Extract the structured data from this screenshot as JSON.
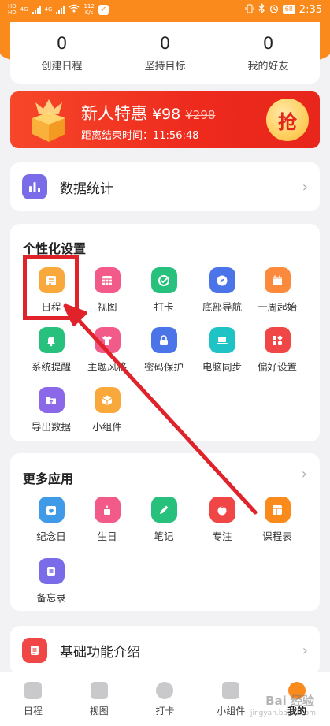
{
  "status_bar": {
    "net_label_1": "HD",
    "net_label_2": "HD",
    "gen_1": "4G",
    "gen_2": "4G",
    "speed_value": "112",
    "speed_unit": "K/s",
    "battery": "68",
    "time": "2:35"
  },
  "stats": [
    {
      "value": "0",
      "label": "创建日程"
    },
    {
      "value": "0",
      "label": "坚持目标"
    },
    {
      "value": "0",
      "label": "我的好友"
    }
  ],
  "promo": {
    "title": "新人特惠",
    "price": "¥98",
    "old_price": "¥298",
    "countdown": "距离结束时间：11:56:48",
    "button": "抢"
  },
  "data_stats": {
    "label": "数据统计",
    "color": "#7a6be8"
  },
  "personalize": {
    "title": "个性化设置",
    "items": [
      {
        "label": "日程",
        "icon": "schedule-icon",
        "color": "#f9a93c"
      },
      {
        "label": "视图",
        "icon": "grid-view-icon",
        "color": "#f25a8a"
      },
      {
        "label": "打卡",
        "icon": "checkin-icon",
        "color": "#27c07d"
      },
      {
        "label": "底部导航",
        "icon": "compass-icon",
        "color": "#4b74e8"
      },
      {
        "label": "一周起始",
        "icon": "calendar-icon",
        "color": "#fb8a3c"
      },
      {
        "label": "系统提醒",
        "icon": "bell-icon",
        "color": "#27c07d"
      },
      {
        "label": "主题风格",
        "icon": "shirt-icon",
        "color": "#f25a8a"
      },
      {
        "label": "密码保护",
        "icon": "lock-icon",
        "color": "#4b74e8"
      },
      {
        "label": "电脑同步",
        "icon": "laptop-icon",
        "color": "#1fc3c6"
      },
      {
        "label": "偏好设置",
        "icon": "apps-icon",
        "color": "#f04646"
      },
      {
        "label": "导出数据",
        "icon": "export-icon",
        "color": "#8a68e8"
      },
      {
        "label": "小组件",
        "icon": "widget-icon",
        "color": "#f9a93c"
      }
    ]
  },
  "more_apps": {
    "title": "更多应用",
    "items": [
      {
        "label": "纪念日",
        "icon": "anniversary-icon",
        "color": "#3f9ae8"
      },
      {
        "label": "生日",
        "icon": "birthday-icon",
        "color": "#f25a8a"
      },
      {
        "label": "笔记",
        "icon": "note-icon",
        "color": "#27c07d"
      },
      {
        "label": "专注",
        "icon": "tomato-icon",
        "color": "#f04646"
      },
      {
        "label": "课程表",
        "icon": "timetable-icon",
        "color": "#fb8a1c"
      },
      {
        "label": "备忘录",
        "icon": "memo-icon",
        "color": "#7a6be8"
      }
    ]
  },
  "features": {
    "label": "基础功能介绍",
    "color": "#f04646"
  },
  "tabs": [
    {
      "label": "日程"
    },
    {
      "label": "视图"
    },
    {
      "label": "打卡"
    },
    {
      "label": "小组件"
    },
    {
      "label": "我的"
    }
  ],
  "watermark": {
    "text": "Bai 经验",
    "sub": "jingyan.baidu.com"
  },
  "colors": {
    "accent": "#fb8a1c",
    "annotation": "#e0222a"
  }
}
